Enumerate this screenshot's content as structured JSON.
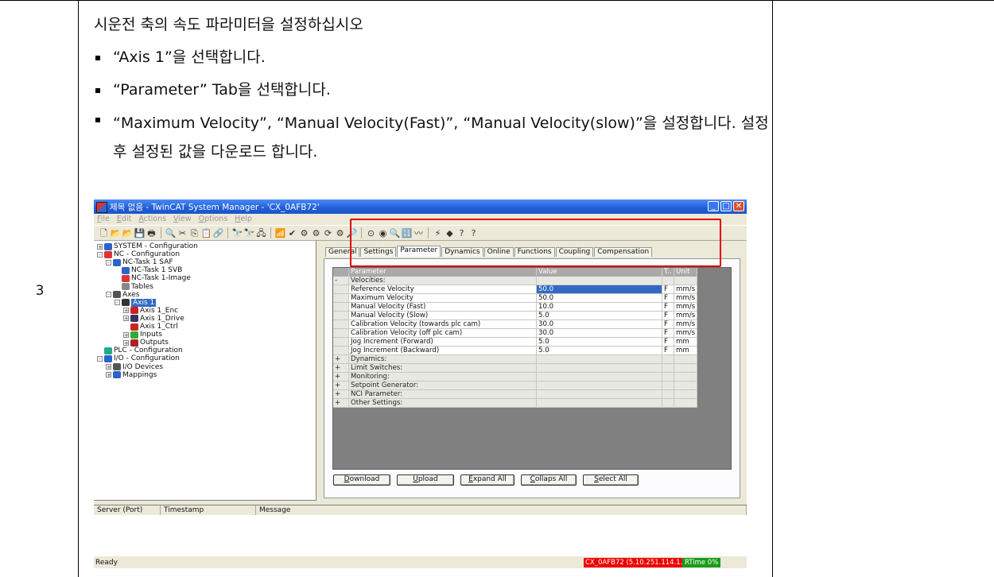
{
  "doc": {
    "step_number": "3",
    "title": "시운전 축의 속도 파라미터을 설정하십시오",
    "bullets": [
      "“Axis 1”을 선택합니다.",
      "“Parameter” Tab을 선택합니다.",
      "“Maximum Velocity”, “Manual Velocity(Fast)”, “Manual Velocity(slow)”을 설정합니다. 설정 후 설정된 값을 다운로드 합니다."
    ]
  },
  "app": {
    "title": "제목 없음 - TwinCAT System Manager - 'CX_0AFB72'",
    "menu": [
      "File",
      "Edit",
      "Actions",
      "View",
      "Options",
      "Help"
    ],
    "toolbar_icons": [
      "new-icon",
      "open-icon",
      "open-folder-icon",
      "save-icon",
      "print-icon",
      "print-preview-icon",
      "cut-icon",
      "copy-icon",
      "paste-icon",
      "paste-link-icon",
      "find-icon",
      "find-next-icon",
      "network-icon",
      "activate-icon",
      "check-icon",
      "generate-mappings-icon",
      "config-mode-icon",
      "reload-icon",
      "toggle-free-run-icon",
      "scan-icon",
      "target-icon",
      "nc-icon",
      "zoom-icon",
      "value-icon",
      "scope-icon",
      "io-icon",
      "go-icon",
      "help-icon",
      "about-icon"
    ],
    "tree": [
      {
        "label": "SYSTEM - Configuration",
        "expander": "+"
      },
      {
        "label": "NC - Configuration",
        "expander": "-"
      },
      {
        "label": "NC-Task 1 SAF",
        "expander": "-"
      },
      {
        "label": "NC-Task 1 SVB",
        "expander": ""
      },
      {
        "label": "NC-Task 1-Image",
        "expander": ""
      },
      {
        "label": "Tables",
        "expander": ""
      },
      {
        "label": "Axes",
        "expander": "-"
      },
      {
        "label": "Axis 1",
        "expander": "-"
      },
      {
        "label": "Axis 1_Enc",
        "expander": "+"
      },
      {
        "label": "Axis 1_Drive",
        "expander": "+"
      },
      {
        "label": "Axis 1_Ctrl",
        "expander": ""
      },
      {
        "label": "Inputs",
        "expander": "+"
      },
      {
        "label": "Outputs",
        "expander": "+"
      },
      {
        "label": "PLC - Configuration",
        "expander": ""
      },
      {
        "label": "I/O - Configuration",
        "expander": "-"
      },
      {
        "label": "I/O Devices",
        "expander": "+"
      },
      {
        "label": "Mappings",
        "expander": "+"
      }
    ],
    "tabs": [
      "General",
      "Settings",
      "Parameter",
      "Dynamics",
      "Online",
      "Functions",
      "Coupling",
      "Compensation"
    ],
    "active_tab": "Parameter",
    "grid_headers": {
      "param": "Parameter",
      "value": "Value",
      "type": "T..",
      "unit": "Unit"
    },
    "grid_rows": [
      {
        "kind": "cat",
        "mark": "-",
        "param": "Velocities:",
        "value": "",
        "type": "",
        "unit": ""
      },
      {
        "kind": "dat",
        "mark": "",
        "param": "Reference Velocity",
        "value": "50.0",
        "type": "F",
        "unit": "mm/s",
        "selected": true
      },
      {
        "kind": "dat",
        "mark": "",
        "param": "Maximum Velocity",
        "value": "50.0",
        "type": "F",
        "unit": "mm/s"
      },
      {
        "kind": "dat",
        "mark": "",
        "param": "Manual Velocity (Fast)",
        "value": "10.0",
        "type": "F",
        "unit": "mm/s"
      },
      {
        "kind": "dat",
        "mark": "",
        "param": "Manual Velocity (Slow)",
        "value": "5.0",
        "type": "F",
        "unit": "mm/s"
      },
      {
        "kind": "dat",
        "mark": "",
        "param": "Calibration Velocity (towards plc cam)",
        "value": "30.0",
        "type": "F",
        "unit": "mm/s"
      },
      {
        "kind": "dat",
        "mark": "",
        "param": "Calibration Velocity (off plc cam)",
        "value": "30.0",
        "type": "F",
        "unit": "mm/s"
      },
      {
        "kind": "dat",
        "mark": "",
        "param": "Jog Increment (Forward)",
        "value": "5.0",
        "type": "F",
        "unit": "mm"
      },
      {
        "kind": "dat",
        "mark": "",
        "param": "Jog Increment (Backward)",
        "value": "5.0",
        "type": "F",
        "unit": "mm"
      },
      {
        "kind": "cat",
        "mark": "+",
        "param": "Dynamics:",
        "value": "",
        "type": "",
        "unit": ""
      },
      {
        "kind": "cat",
        "mark": "+",
        "param": "Limit Switches:",
        "value": "",
        "type": "",
        "unit": ""
      },
      {
        "kind": "cat",
        "mark": "+",
        "param": "Monitoring:",
        "value": "",
        "type": "",
        "unit": ""
      },
      {
        "kind": "cat",
        "mark": "+",
        "param": "Setpoint Generator:",
        "value": "",
        "type": "",
        "unit": ""
      },
      {
        "kind": "cat",
        "mark": "+",
        "param": "NCI Parameter:",
        "value": "",
        "type": "",
        "unit": ""
      },
      {
        "kind": "cat",
        "mark": "+",
        "param": "Other Settings:",
        "value": "",
        "type": "",
        "unit": ""
      }
    ],
    "buttons": [
      "Download",
      "Upload",
      "Expand All",
      "Collaps All",
      "Select All"
    ],
    "log_headers": [
      "Server (Port)",
      "Timestamp",
      "Message"
    ],
    "status": {
      "ready": "Ready",
      "server": "CX_0AFB72 (5.10.251.114.1.1)",
      "rtime": "RTime 0%"
    },
    "colors": {
      "highlight": "#e00000",
      "titlebar": "#1f5ed8",
      "selection": "#316ac5"
    }
  }
}
